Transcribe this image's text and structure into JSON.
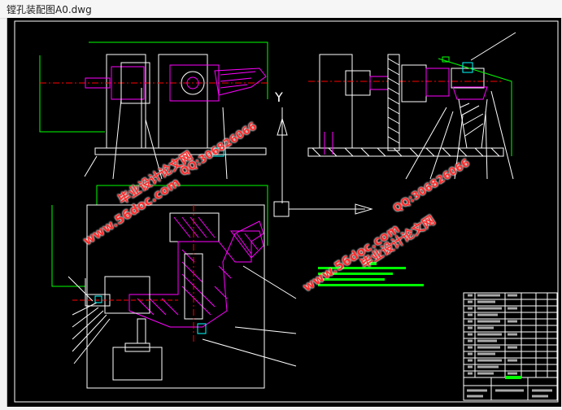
{
  "window": {
    "title": "镗孔装配图A0.dwg"
  },
  "drawing": {
    "axis_label_y": "Y"
  },
  "watermarks": {
    "site": "www.56doc.com",
    "qq": "QQ:306826066",
    "brand": "毕业设计论文网"
  },
  "colors": {
    "background": "#000000",
    "outline": "#ffffff",
    "part": "#ff00ff",
    "centerline": "#ff0000",
    "frame": "#00ff00",
    "hatch": "#ff00ff",
    "watermark": "#ff2d2d"
  }
}
